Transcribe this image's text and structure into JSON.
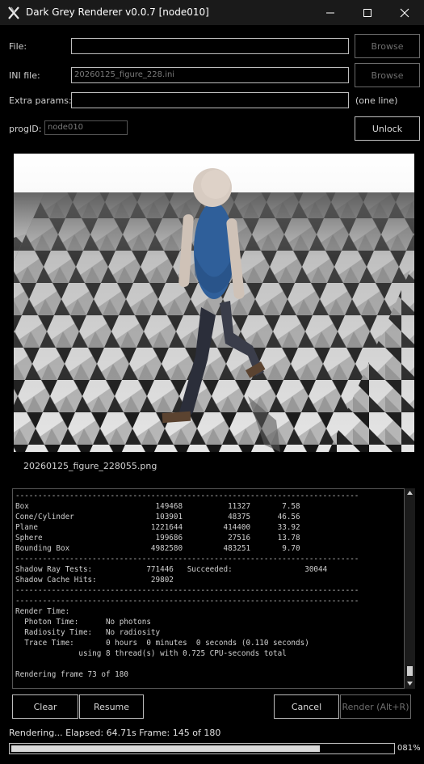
{
  "window": {
    "title": "Dark Grey Renderer v0.0.7 [node010]"
  },
  "form": {
    "file_label": "File:",
    "file_value": "",
    "ini_label": "INI file:",
    "ini_value": "20260125_figure_228.ini",
    "extra_label": "Extra params:",
    "extra_value": "",
    "extra_hint": "(one line)",
    "progid_label": "progID:",
    "progid_value": "node010",
    "browse_label": "Browse",
    "unlock_label": "Unlock"
  },
  "render": {
    "output_filename": "20260125_figure_228055.png"
  },
  "log": {
    "lines": [
      "----------------------------------------------------------------------------",
      "Box                            149468          11327       7.58",
      "Cone/Cylinder                  103901          48375      46.56",
      "Plane                         1221644         414400      33.92",
      "Sphere                         199686          27516      13.78",
      "Bounding Box                  4982580         483251       9.70",
      "----------------------------------------------------------------------------",
      "Shadow Ray Tests:            771446   Succeeded:                30044",
      "Shadow Cache Hits:            29802",
      "----------------------------------------------------------------------------",
      "----------------------------------------------------------------------------",
      "Render Time:",
      "  Photon Time:      No photons",
      "  Radiosity Time:   No radiosity",
      "  Trace Time:       0 hours  0 minutes  0 seconds (0.110 seconds)",
      "              using 8 thread(s) with 0.725 CPU-seconds total",
      "",
      "Rendering frame 73 of 180"
    ]
  },
  "buttons": {
    "clear": "Clear",
    "resume": "Resume",
    "cancel": "Cancel",
    "render": "Render (Alt+R)"
  },
  "status": {
    "text": "Rendering...  Elapsed: 64.71s Frame: 145 of 180",
    "progress_percent": 81,
    "progress_label": "081%"
  },
  "icons": {
    "app": "x-logo-icon",
    "minimize": "minimize-icon",
    "maximize": "maximize-icon",
    "close": "close-icon"
  }
}
